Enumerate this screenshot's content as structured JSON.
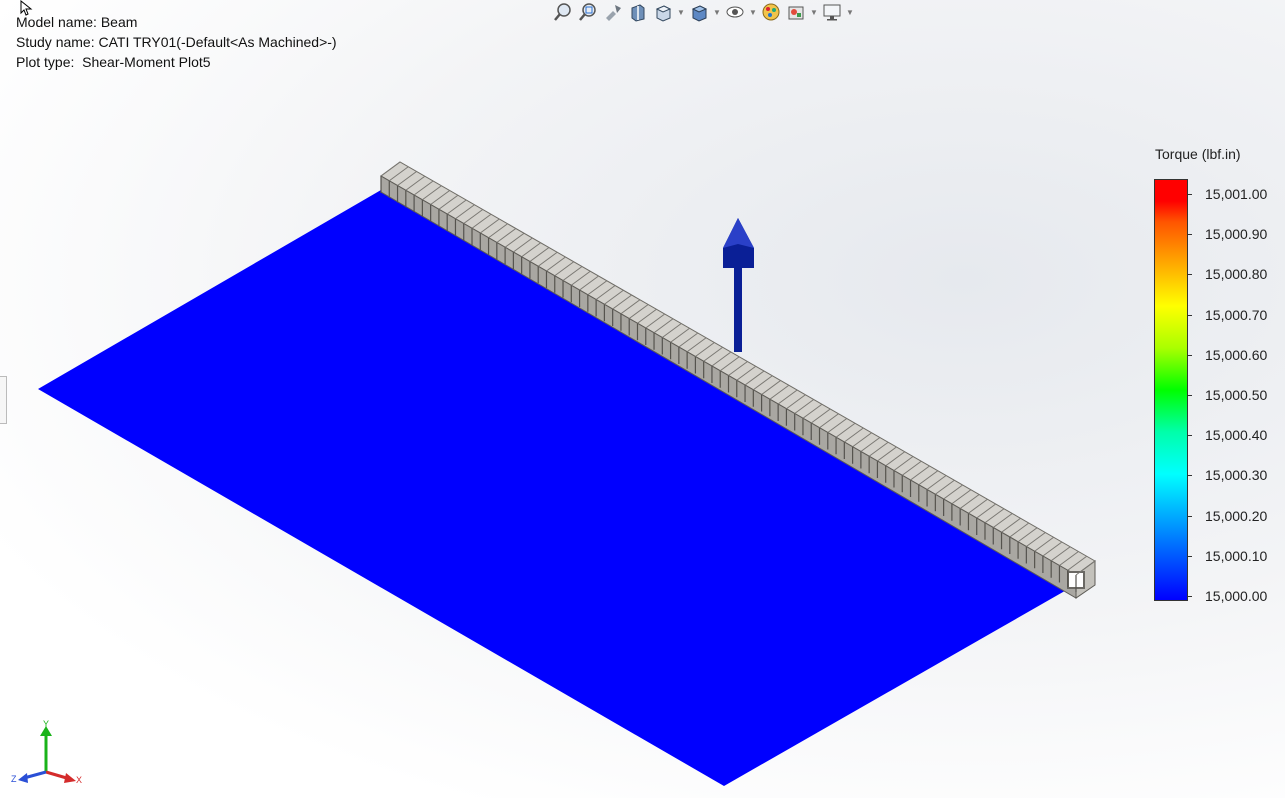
{
  "info": {
    "model_name": "Model name: Beam",
    "study_name": "Study name: CATI TRY01(-Default<As Machined>-)",
    "plot_type": "Plot type:  Shear-Moment Plot5"
  },
  "toolbar": {
    "items": [
      {
        "icon": "zoom-to-fit-icon"
      },
      {
        "icon": "zoom-to-area-icon"
      },
      {
        "icon": "previous-view-icon"
      },
      {
        "icon": "section-view-icon"
      },
      {
        "icon": "view-orientation-icon"
      },
      {
        "icon": "display-style-icon"
      },
      {
        "icon": "hide-show-items-icon"
      },
      {
        "icon": "edit-appearance-icon"
      },
      {
        "icon": "apply-scene-icon"
      },
      {
        "icon": "view-settings-icon"
      }
    ]
  },
  "legend": {
    "title": "Torque (lbf.in)",
    "labels": [
      "15,001.00",
      "15,000.90",
      "15,000.80",
      "15,000.70",
      "15,000.60",
      "15,000.50",
      "15,000.40",
      "15,000.30",
      "15,000.20",
      "15,000.10",
      "15,000.00"
    ],
    "colors": [
      "#ff0000",
      "#ff5500",
      "#ffaa00",
      "#ffff00",
      "#aaff00",
      "#00ff00",
      "#00ffaa",
      "#00ffff",
      "#00aaff",
      "#0055ff",
      "#0000ff"
    ]
  },
  "triad": {
    "y_label": "Y",
    "x_label": "X",
    "z_label": "Z"
  },
  "colors": {
    "plate": "#0000ff",
    "beam": "#a8a6a1",
    "beam_edge": "#5a5853",
    "arrow": "#0a1f96"
  }
}
